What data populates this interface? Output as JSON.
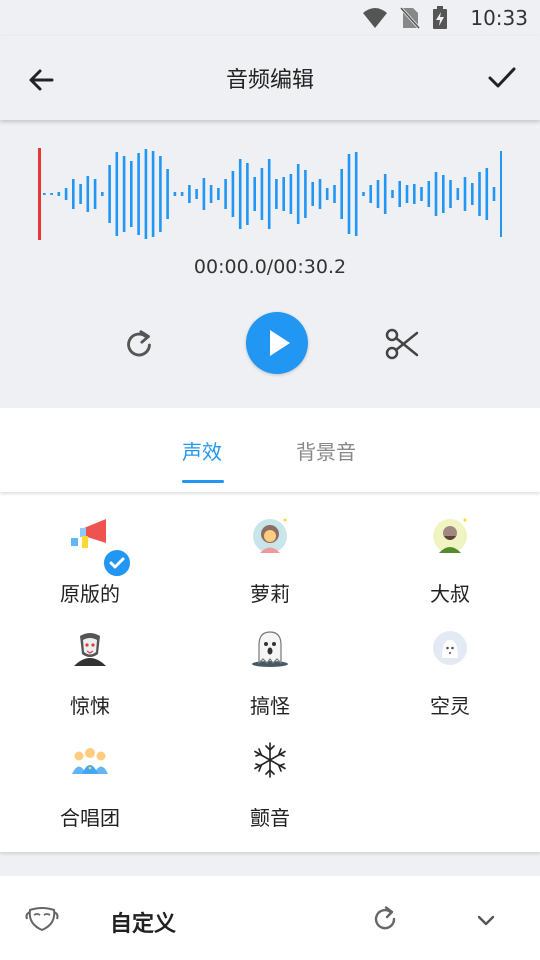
{
  "status_bar": {
    "time": "10:33"
  },
  "app_bar": {
    "title": "音频编辑"
  },
  "editor": {
    "timecode": "00:00.0/00:30.2",
    "playhead_color": "#e53935",
    "wave_color": "#2196f3"
  },
  "tabs": [
    {
      "label": "声效",
      "active": true
    },
    {
      "label": "背景音",
      "active": false
    }
  ],
  "effects": [
    {
      "label": "原版的",
      "icon": "megaphone-icon",
      "selected": true
    },
    {
      "label": "萝莉",
      "icon": "girl-avatar-icon",
      "selected": false
    },
    {
      "label": "大叔",
      "icon": "man-avatar-icon",
      "selected": false
    },
    {
      "label": "惊悚",
      "icon": "vampire-icon",
      "selected": false
    },
    {
      "label": "搞怪",
      "icon": "ghost-icon",
      "selected": false
    },
    {
      "label": "空灵",
      "icon": "spirit-icon",
      "selected": false
    },
    {
      "label": "合唱团",
      "icon": "choir-icon",
      "selected": false
    },
    {
      "label": "颤音",
      "icon": "snowflake-icon",
      "selected": false
    }
  ],
  "custom": {
    "label": "自定义"
  },
  "colors": {
    "accent": "#2196f3",
    "background": "#eef0f3"
  }
}
